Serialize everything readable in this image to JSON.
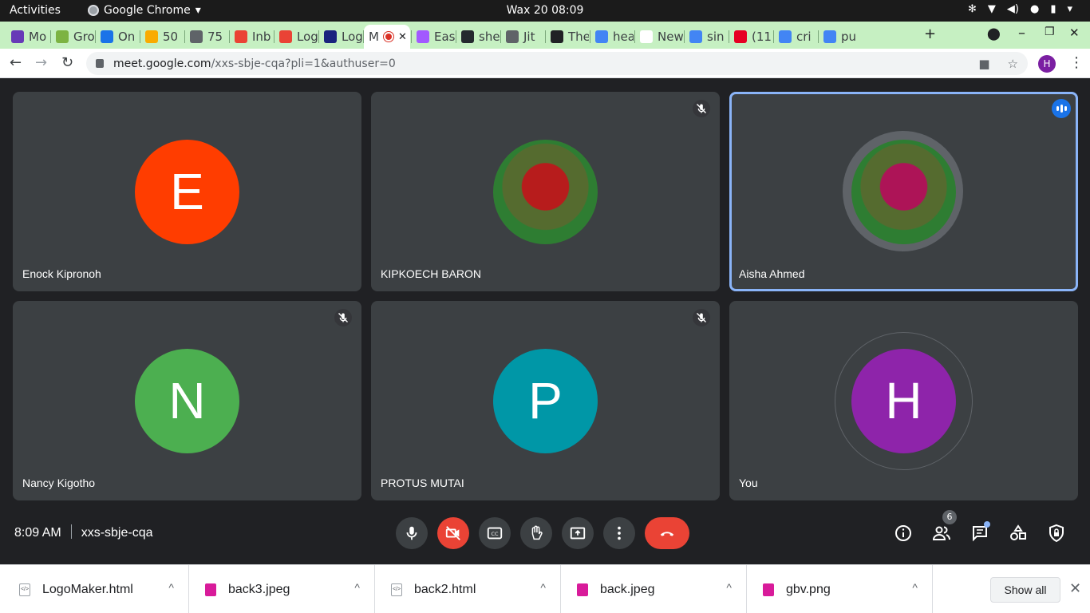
{
  "topbar": {
    "activities": "Activities",
    "app_name": "Google Chrome",
    "clock": "Wax 20  08:09"
  },
  "tabs": [
    {
      "label": "Mo",
      "color": "#673ab7"
    },
    {
      "label": "Gro",
      "color": "#7cb342"
    },
    {
      "label": "On",
      "color": "#1a73e8"
    },
    {
      "label": "50",
      "color": "#f9ab00"
    },
    {
      "label": "75",
      "color": "#5f6368"
    },
    {
      "label": "Inb",
      "color": "#ea4335"
    },
    {
      "label": "Log",
      "color": "#ea4335"
    },
    {
      "label": "Log",
      "color": "#1a237e"
    },
    {
      "label": "M",
      "color": "#ffffff",
      "active": true
    },
    {
      "label": "Eas",
      "color": "#a259ff"
    },
    {
      "label": "she",
      "color": "#24292e"
    },
    {
      "label": "Jit",
      "color": "#5f6368"
    },
    {
      "label": "The",
      "color": "#202124"
    },
    {
      "label": "hea",
      "color": "#4285f4"
    },
    {
      "label": "New T",
      "color": "#ffffff"
    },
    {
      "label": "sin",
      "color": "#4285f4"
    },
    {
      "label": "(11",
      "color": "#e60023"
    },
    {
      "label": "cri",
      "color": "#4285f4"
    },
    {
      "label": "pu",
      "color": "#4285f4"
    }
  ],
  "tabstrip": {
    "new_tab": "+",
    "close_active": "✕"
  },
  "toolbar": {
    "url_host": "meet.google.com",
    "url_path": "/xxs-sbje-cqa?pli=1&authuser=0",
    "profile_initial": "H"
  },
  "participants": [
    {
      "name": "Enock Kipronoh",
      "initial": "E",
      "color": "#ff3d00",
      "muted": false
    },
    {
      "name": "KIPKOECH BARON",
      "initial": "",
      "color": "#b71c1c",
      "muted": true
    },
    {
      "name": "Aisha Ahmed",
      "initial": "",
      "color": "#ad1457",
      "muted": false,
      "speaking": true
    },
    {
      "name": "Nancy Kigotho",
      "initial": "N",
      "color": "#4caf50",
      "muted": true
    },
    {
      "name": "PROTUS MUTAI",
      "initial": "P",
      "color": "#0097a7",
      "muted": true
    },
    {
      "name": "You",
      "initial": "H",
      "color": "#8e24aa",
      "muted": false
    }
  ],
  "meeting": {
    "time": "8:09 AM",
    "code": "xxs-sbje-cqa",
    "participant_count": "6"
  },
  "downloads": [
    {
      "file": "LogoMaker.html",
      "type": "html"
    },
    {
      "file": "back3.jpeg",
      "type": "img"
    },
    {
      "file": "back2.html",
      "type": "html"
    },
    {
      "file": "back.jpeg",
      "type": "img"
    },
    {
      "file": "gbv.png",
      "type": "img"
    }
  ],
  "downloads_bar": {
    "show_all": "Show all"
  }
}
